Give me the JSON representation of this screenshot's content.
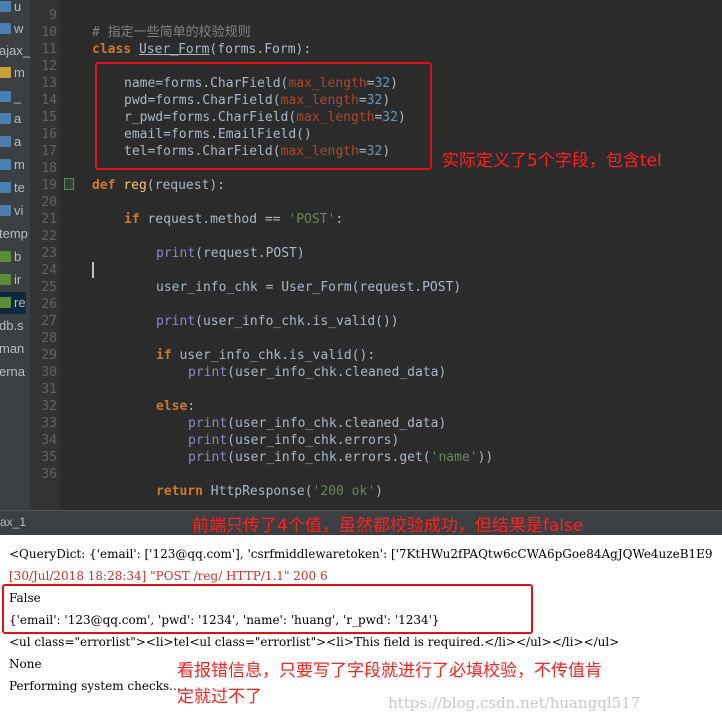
{
  "sidebar": {
    "items": [
      {
        "label": "u",
        "icon": "python-file-icon",
        "color": "#4a7fb0"
      },
      {
        "label": "w",
        "icon": "python-file-icon",
        "color": "#4a7fb0"
      },
      {
        "label": "ajax_",
        "icon": "",
        "color": ""
      },
      {
        "label": "m",
        "icon": "folder-icon",
        "color": "#c9a03a"
      },
      {
        "label": "_",
        "icon": "python-file-icon",
        "color": "#4a7fb0"
      },
      {
        "label": "a",
        "icon": "python-file-icon",
        "color": "#4a7fb0"
      },
      {
        "label": "a",
        "icon": "python-file-icon",
        "color": "#4a7fb0"
      },
      {
        "label": "m",
        "icon": "python-file-icon",
        "color": "#4a7fb0"
      },
      {
        "label": "te",
        "icon": "python-file-icon",
        "color": "#4a7fb0"
      },
      {
        "label": "vi",
        "icon": "python-file-icon",
        "color": "#4a7fb0"
      },
      {
        "label": "temp",
        "icon": "",
        "color": ""
      },
      {
        "label": "b",
        "icon": "html-file-icon",
        "color": "#5b8c3a"
      },
      {
        "label": "ir",
        "icon": "html-file-icon",
        "color": "#5b8c3a"
      },
      {
        "label": "re",
        "icon": "html-file-icon",
        "color": "#5b8c3a"
      },
      {
        "label": "db.s",
        "icon": "",
        "color": ""
      },
      {
        "label": "man",
        "icon": "",
        "color": ""
      },
      {
        "label": "erna",
        "icon": "",
        "color": ""
      }
    ]
  },
  "editor": {
    "line_numbers": [
      "9",
      "10",
      "11",
      "12",
      "13",
      "14",
      "15",
      "16",
      "17",
      "18",
      "19",
      "20",
      "21",
      "22",
      "23",
      "24",
      "25",
      "26",
      "27",
      "28",
      "29",
      "30",
      "31",
      "32",
      "33",
      "34",
      "35",
      "36"
    ],
    "lines": {
      "comment": "# 指定一些简单的校验规则",
      "class_kw": "class",
      "class_name": "User_Form",
      "class_base": "(forms.Form):",
      "f1_a": "name=forms.CharField(",
      "f2_a": "pwd=forms.CharField(",
      "f3_a": "r_pwd=forms.CharField(",
      "f4": "email=forms.EmailField()",
      "f5_a": "tel=forms.CharField(",
      "param": "max_length",
      "eq": "=",
      "num": "32",
      "close": ")",
      "def_kw": "def",
      "def_name": "reg",
      "def_rest": "(request):",
      "if_kw": "if",
      "if_rest": "request.method == ",
      "post_str": "'POST'",
      "colon": ":",
      "print_kw": "print",
      "p1_arg": "(request.POST)",
      "assign": "user_info_chk = User_Form(request.POST)",
      "p2_arg": "(user_info_chk.is_valid())",
      "if2_rest": "user_info_chk.is_valid():",
      "p3_arg": "(user_info_chk.cleaned_data)",
      "else_kw": "else",
      "p4_arg": "(user_info_chk.cleaned_data)",
      "p5_arg": "(user_info_chk.errors)",
      "p6_a": "(user_info_chk.errors.get(",
      "p6_str": "'name'",
      "p6_b": "))",
      "return_kw": "return",
      "return_a": "HttpResponse(",
      "return_str": "'200 ok'",
      "return_b": ")"
    }
  },
  "annotations": {
    "a1": "实际定义了5个字段，包含tel",
    "a2": "前端只传了4个值，虽然都校验成功，但结果是false",
    "a3_line1": "看报错信息，只要写了字段就进行了必填校验，不传值肯",
    "a3_line2": "定就过不了"
  },
  "run_tab": {
    "label": "ax_1"
  },
  "console": {
    "lines": [
      "<QueryDict: {'email': ['123@qq.com'], 'csrfmiddlewaretoken': ['7KtHWu2fPAQtw6cCWA6pGoe84AgJQWe4uzeB1E9",
      "[30/Jul/2018 18:28:34] \"POST /reg/ HTTP/1.1\" 200 6",
      "False",
      "{'email': '123@qq.com', 'pwd': '1234', 'name': 'huang', 'r_pwd': '1234'}",
      "<ul class=\"errorlist\"><li>tel<ul class=\"errorlist\"><li>This field is required.</li></ul></li></ul>",
      "None",
      "Performing system checks..."
    ]
  },
  "watermark": "https://blog.csdn.net/huangql517",
  "colors": {
    "annotation_red": "#e0101a",
    "keyword": "#cc7832",
    "number": "#6897bb",
    "string": "#6a8759",
    "builtin": "#8888c6",
    "param": "#aa4926"
  }
}
